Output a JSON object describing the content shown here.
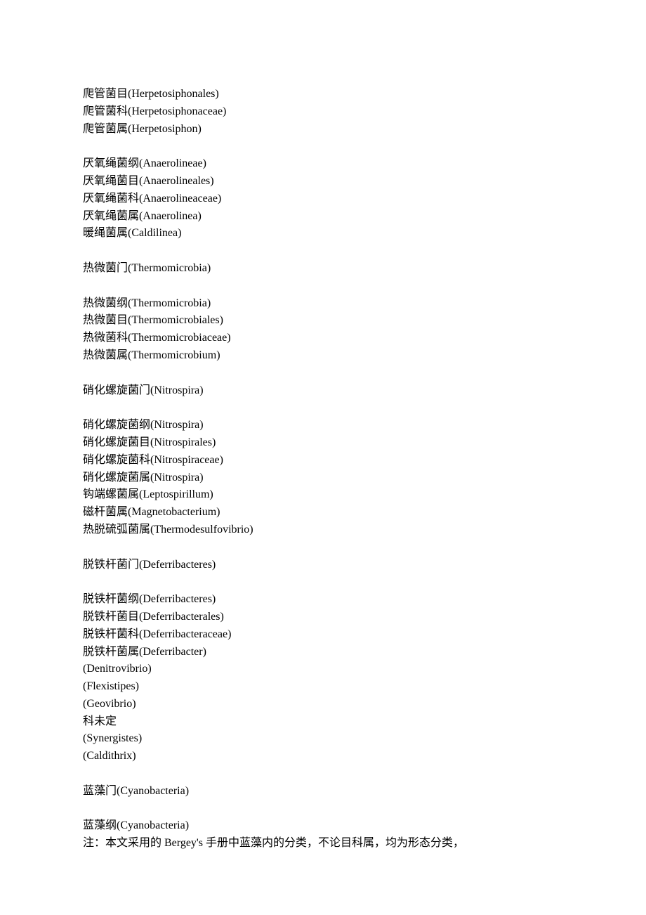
{
  "lines": [
    "爬管菌目(Herpetosiphonales)",
    "爬管菌科(Herpetosiphonaceae)",
    "爬管菌属(Herpetosiphon)",
    "",
    "厌氧绳菌纲(Anaerolineae)",
    "厌氧绳菌目(Anaerolineales)",
    "厌氧绳菌科(Anaerolineaceae)",
    "厌氧绳菌属(Anaerolinea)",
    "暖绳菌属(Caldilinea)",
    "",
    "热微菌门(Thermomicrobia)",
    "",
    "热微菌纲(Thermomicrobia)",
    "热微菌目(Thermomicrobiales)",
    "热微菌科(Thermomicrobiaceae)",
    "热微菌属(Thermomicrobium)",
    "",
    "硝化螺旋菌门(Nitrospira)",
    "",
    "硝化螺旋菌纲(Nitrospira)",
    "硝化螺旋菌目(Nitrospirales)",
    "硝化螺旋菌科(Nitrospiraceae)",
    "硝化螺旋菌属(Nitrospira)",
    "钩端螺菌属(Leptospirillum)",
    "磁杆菌属(Magnetobacterium)",
    "热脱硫弧菌属(Thermodesulfovibrio)",
    "",
    "脱铁杆菌门(Deferribacteres)",
    "",
    "脱铁杆菌纲(Deferribacteres)",
    "脱铁杆菌目(Deferribacterales)",
    "脱铁杆菌科(Deferribacteraceae)",
    "脱铁杆菌属(Deferribacter)",
    "(Denitrovibrio)",
    "(Flexistipes)",
    "(Geovibrio)",
    "科未定",
    "(Synergistes)",
    "(Caldithrix)",
    "",
    "蓝藻门(Cyanobacteria)",
    "",
    "蓝藻纲(Cyanobacteria)",
    "注：本文采用的 Bergey's 手册中蓝藻内的分类，不论目科属，均为形态分类，"
  ]
}
